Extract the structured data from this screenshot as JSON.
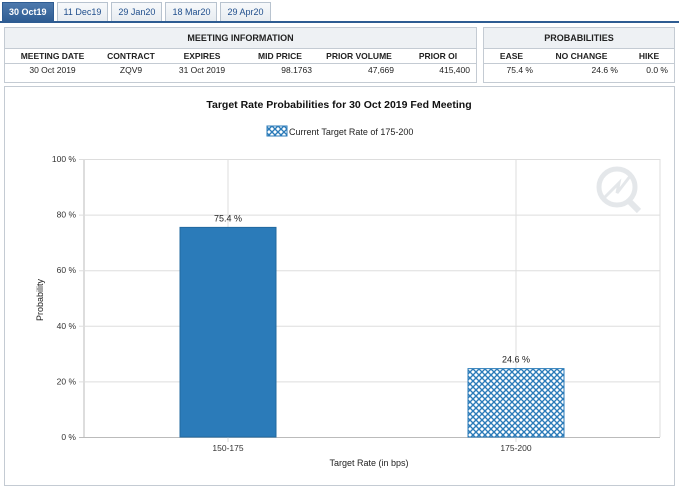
{
  "tabs": [
    "30 Oct19",
    "11 Dec19",
    "29 Jan20",
    "18 Mar20",
    "29 Apr20"
  ],
  "active_tab": 0,
  "meeting_info": {
    "title": "MEETING INFORMATION",
    "headers": [
      "MEETING DATE",
      "CONTRACT",
      "EXPIRES",
      "MID PRICE",
      "PRIOR VOLUME",
      "PRIOR OI"
    ],
    "values": [
      "30 Oct 2019",
      "ZQV9",
      "31 Oct 2019",
      "98.1763",
      "47,669",
      "415,400"
    ]
  },
  "probabilities": {
    "title": "PROBABILITIES",
    "headers": [
      "EASE",
      "NO CHANGE",
      "HIKE"
    ],
    "values": [
      "75.4 %",
      "24.6 %",
      "0.0 %"
    ]
  },
  "colors": {
    "tab_active": "#2e5c92",
    "bar_solid": "#2b7bb9",
    "bar_hatch": "#2b7bb9",
    "grid": "#dddddd"
  },
  "chart_data": {
    "type": "bar",
    "title": "Target Rate Probabilities for 30 Oct 2019 Fed Meeting",
    "legend": "Current Target Rate of 175-200",
    "legend_position": "top-center",
    "xlabel": "Target Rate (in bps)",
    "ylabel": "Probability",
    "categories": [
      "150-175",
      "175-200"
    ],
    "values": [
      75.4,
      24.6
    ],
    "data_labels": [
      "75.4 %",
      "24.6 %"
    ],
    "fill": [
      "solid",
      "hatched"
    ],
    "ylim": [
      0,
      100
    ],
    "yticks": [
      0,
      20,
      40,
      60,
      80,
      100
    ],
    "ytick_labels": [
      "0 %",
      "20 %",
      "40 %",
      "60 %",
      "80 %",
      "100 %"
    ],
    "grid": true
  }
}
